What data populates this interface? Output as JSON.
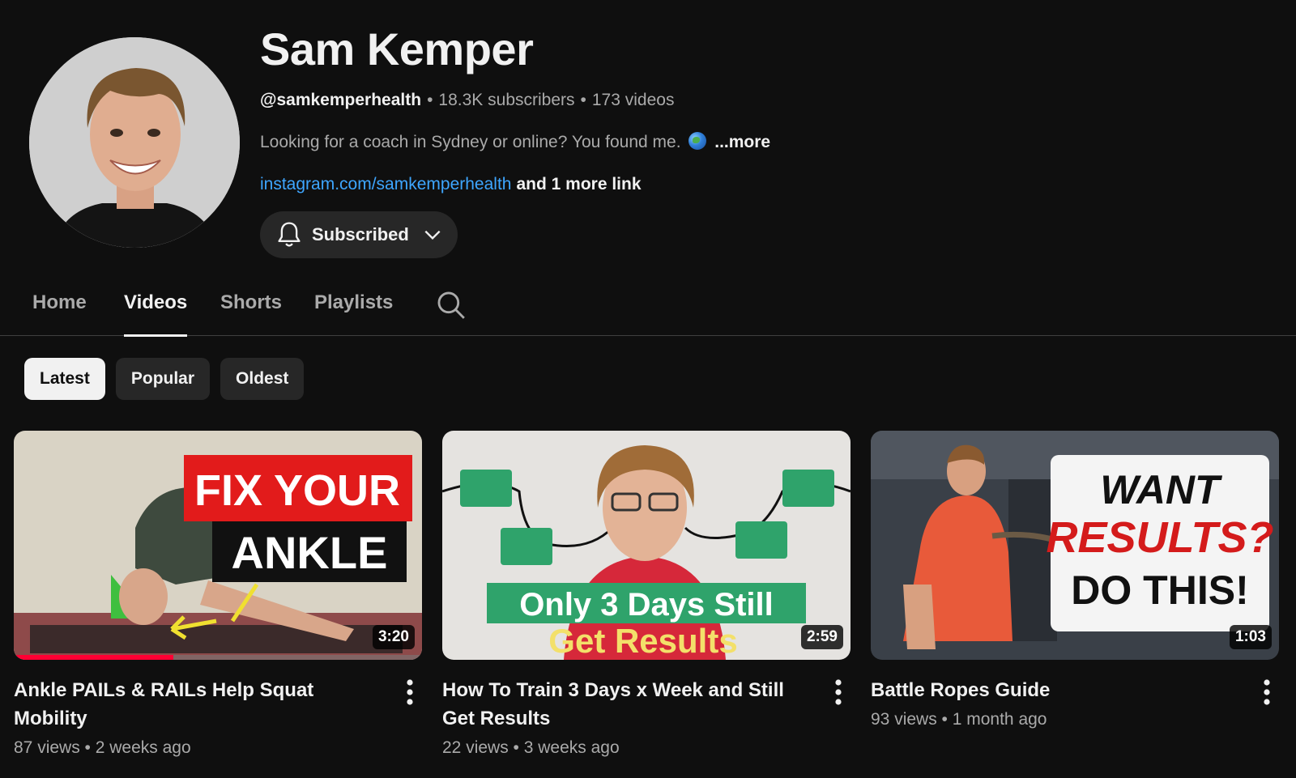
{
  "channel": {
    "name": "Sam Kemper",
    "handle": "@samkemperhealth",
    "subscribers": "18.3K subscribers",
    "videos_count": "173 videos",
    "description": "Looking for a coach in Sydney or online? You found me.",
    "more_label": "...more",
    "link": "instagram.com/samkemperhealth",
    "more_links": "and 1 more link",
    "subscribe_label": "Subscribed"
  },
  "tabs": [
    {
      "label": "Home"
    },
    {
      "label": "Videos"
    },
    {
      "label": "Shorts"
    },
    {
      "label": "Playlists"
    }
  ],
  "active_tab": "Videos",
  "filters": [
    {
      "label": "Latest"
    },
    {
      "label": "Popular"
    },
    {
      "label": "Oldest"
    }
  ],
  "active_filter": "Latest",
  "videos": [
    {
      "title": "Ankle PAILs & RAILs Help Squat Mobility",
      "views": "87 views",
      "age": "2 weeks ago",
      "duration": "3:20",
      "watch_progress": 0.39,
      "thumb_text_1": "FIX YOUR",
      "thumb_text_2": "ANKLE"
    },
    {
      "title": "How To Train 3 Days x Week and Still Get Results",
      "views": "22 views",
      "age": "3 weeks ago",
      "duration": "2:59",
      "thumb_text_1": "Only 3 Days Still",
      "thumb_text_2": "Get Results"
    },
    {
      "title": "Battle Ropes Guide",
      "views": "93 views",
      "age": "1 month ago",
      "duration": "1:03",
      "thumb_text_1": "WANT",
      "thumb_text_2": "RESULTS?",
      "thumb_text_3": "DO THIS!"
    }
  ],
  "colors": {
    "background": "#0f0f0f",
    "link": "#3ea6ff",
    "progress": "#ff0033",
    "chip": "#272727"
  }
}
